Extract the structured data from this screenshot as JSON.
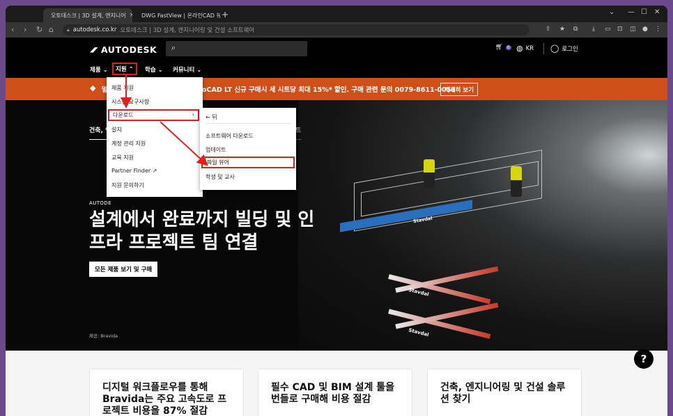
{
  "browser": {
    "tabs": [
      {
        "title": "오토데스크 | 3D 설계, 엔지니어",
        "active": true
      },
      {
        "title": "DWG FastView | 온라인CAD 뷰",
        "active": false
      }
    ],
    "new_tab": "+",
    "url_domain": "autodesk.co.kr",
    "url_title": "오토데스크 | 3D 설계, 엔지니어링 및 건설 소프트웨어"
  },
  "header": {
    "logo": "AUTODESK",
    "search_icon": "search-icon",
    "cart_count": "0",
    "region": "KR",
    "login": "로그인"
  },
  "subnav": {
    "items": [
      "제품",
      "지원",
      "학습",
      "커뮤니티"
    ]
  },
  "banner": {
    "text": "멀티... AutoCAD LT 신규 구매시 세 시트당 최대 15%* 할인. 구매 관련 문의 0079-8611-0053",
    "visible_left": "멀티",
    "visible_right": "oCAD LT 신규 구매시 세 시트당 최대 15%* 할인. 구매 관련 문의 0079-8611-0053",
    "button": "자세히 보기"
  },
  "hero": {
    "tab_left": "건축, 엔",
    "tab_right": "트",
    "eyebrow": "AUTODE",
    "title": "설계에서 완료까지 빌딩 및 인프라 프로젝트 팀 연결",
    "button": "모든 제품 보기 및 구매",
    "credit": "제공: Bravida",
    "lift_brand": "Stavdal"
  },
  "menu_support": {
    "items": [
      "제품 지원",
      "시스템 요구사항",
      "다운로드",
      "설치",
      "계정 관리 지원",
      "교육 지원",
      "Partner Finder",
      "지원 문의하기"
    ],
    "highlighted": "다운로드",
    "submenu_arrow": "›"
  },
  "menu_download": {
    "back": "← 뒤",
    "items": [
      "소프트웨어 다운로드",
      "업데이트",
      "파일 뷰어",
      "학생 및 교사"
    ],
    "highlighted": "파일 뷰어"
  },
  "cards": [
    {
      "text": "디지털 워크플로우를 통해 Bravida는 주요 고속도로 프로젝트 비용을 87% 절감"
    },
    {
      "text": "필수 CAD 및 BIM 설계 툴을 번들로 구매해 비용 절감"
    },
    {
      "text": "건축, 엔지니어링 및 건설 솔루션 찾기"
    }
  ],
  "help": "?",
  "colors": {
    "banner": "#d04f19",
    "highlight": "#e02020",
    "lift": "#2a6fbd"
  }
}
